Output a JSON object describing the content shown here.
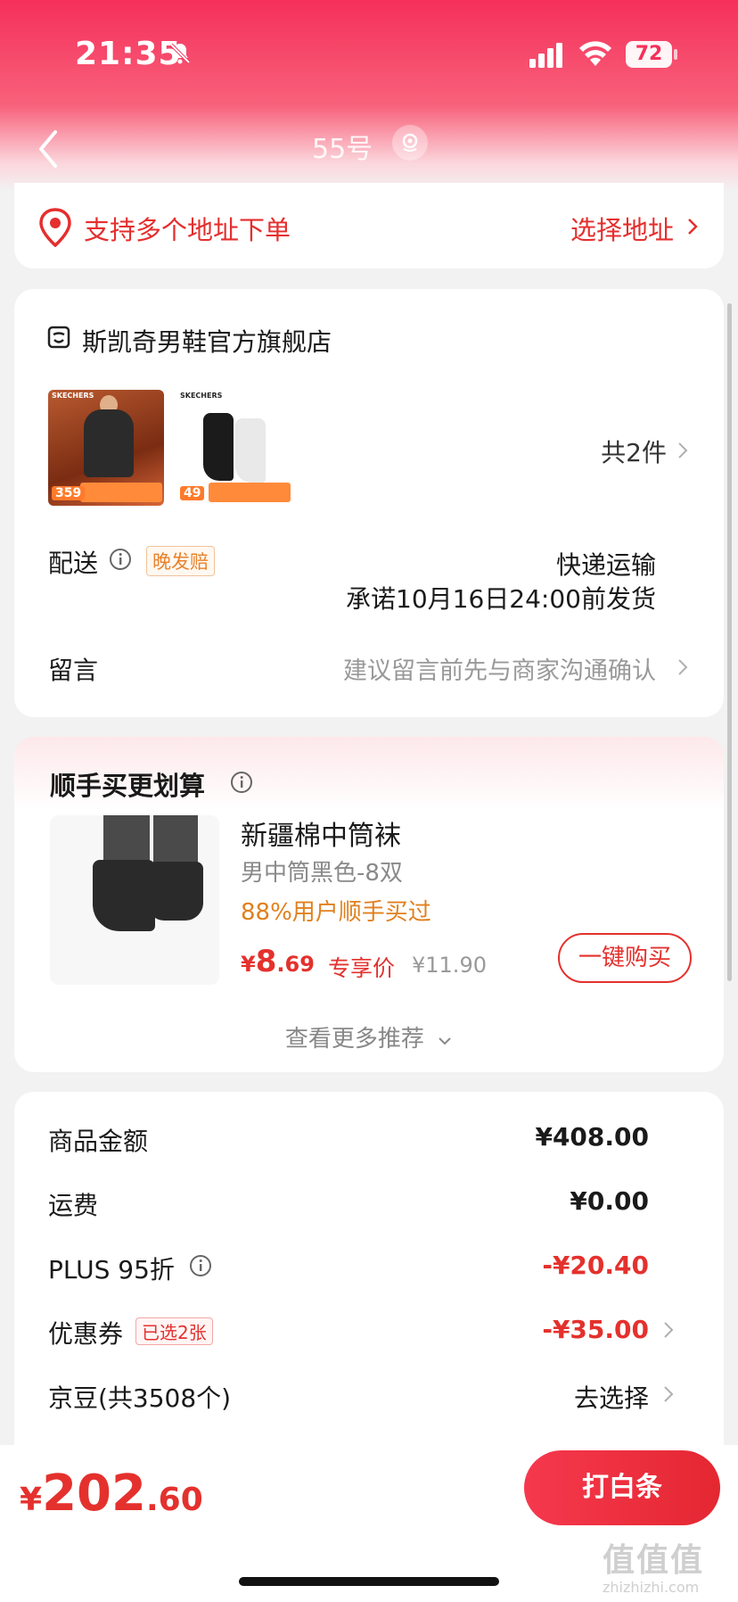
{
  "status_bar": {
    "time": "21:35",
    "battery": "72"
  },
  "nav": {
    "title": "55号"
  },
  "address": {
    "text": "支持多个地址下单",
    "select_label": "选择地址"
  },
  "store": {
    "name": "斯凯奇男鞋官方旗舰店",
    "products": [
      {
        "brand": "SKECHERS",
        "price_tag": "359"
      },
      {
        "brand": "SKECHERS",
        "price_tag": "49"
      }
    ],
    "item_count": "共2件",
    "delivery_label": "配送",
    "late_badge": "晚发赔",
    "delivery_method": "快递运输",
    "delivery_promise": "承诺10月16日24:00前发货",
    "note_label": "留言",
    "note_placeholder": "建议留言前先与商家沟通确认"
  },
  "upsell": {
    "title": "顺手买更划算",
    "product_name": "新疆棉中筒袜",
    "spec": "男中筒黑色-8双",
    "social_proof": "88%用户顺手买过",
    "price_currency": "¥",
    "price_int": "8",
    "price_dec": ".69",
    "exclusive_label": "专享价",
    "original_price": "¥11.90",
    "buy_button": "一键购买",
    "more_label": "查看更多推荐"
  },
  "summary": {
    "goods_label": "商品金额",
    "goods_value": "¥408.00",
    "shipping_label": "运费",
    "shipping_value": "¥0.00",
    "plus_label": "PLUS 95折",
    "plus_value": "-¥20.40",
    "coupon_label": "优惠券",
    "coupon_badge": "已选2张",
    "coupon_value": "-¥35.00",
    "beans_label": "京豆(共3508个)",
    "beans_action": "去选择"
  },
  "bottom": {
    "total_currency": "¥",
    "total_int": "202",
    "total_dec": ".60",
    "pay_button": "打白条",
    "watermark": "值值值",
    "watermark_sub": "zhizhizhi.com"
  },
  "colors": {
    "accent": "#e4312d",
    "header": "#f5305a",
    "orange": "#e0801f"
  }
}
